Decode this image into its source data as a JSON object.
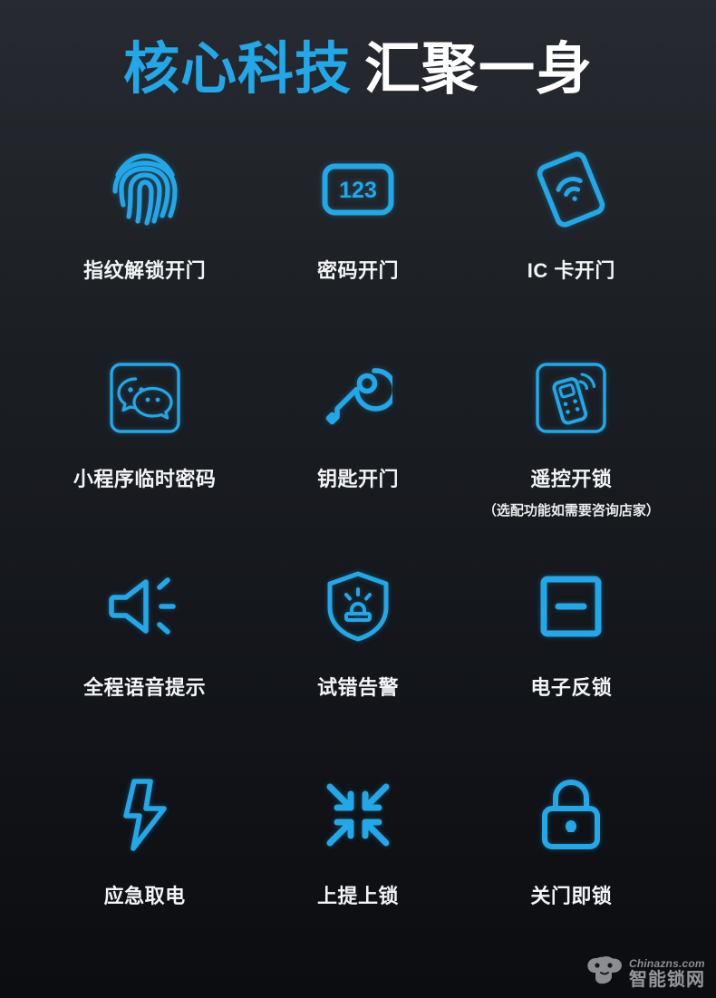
{
  "theme": {
    "accent_color": "#22a7e8",
    "text_color": "#ffffff",
    "background_top": "#272b31",
    "background_bottom": "#0b0d11"
  },
  "heading": {
    "part_blue": "核心科技",
    "part_white": "汇聚一身"
  },
  "features": [
    {
      "icon": "fingerprint-icon",
      "label": "指纹解锁开门",
      "sub": ""
    },
    {
      "icon": "keypad-123-icon",
      "label": "密码开门",
      "sub": "",
      "icon_text": "123"
    },
    {
      "icon": "ic-card-wifi-icon",
      "label": "IC 卡开门",
      "sub": ""
    },
    {
      "icon": "wechat-miniprogram-icon",
      "label": "小程序临时密码",
      "sub": ""
    },
    {
      "icon": "key-icon",
      "label": "钥匙开门",
      "sub": ""
    },
    {
      "icon": "remote-control-icon",
      "label": "遥控开锁",
      "sub": "（选配功能如需要咨询店家）"
    },
    {
      "icon": "speaker-voice-icon",
      "label": "全程语音提示",
      "sub": ""
    },
    {
      "icon": "shield-alarm-icon",
      "label": "试错告警",
      "sub": ""
    },
    {
      "icon": "square-deadbolt-icon",
      "label": "电子反锁",
      "sub": ""
    },
    {
      "icon": "lightning-bolt-icon",
      "label": "应急取电",
      "sub": ""
    },
    {
      "icon": "converging-arrows-icon",
      "label": "上提上锁",
      "sub": ""
    },
    {
      "icon": "padlock-icon",
      "label": "关门即锁",
      "sub": ""
    }
  ],
  "watermark": {
    "logo": "lock-cloud-logo-icon",
    "domain": "Chinazns.com",
    "name": "智能锁网"
  }
}
